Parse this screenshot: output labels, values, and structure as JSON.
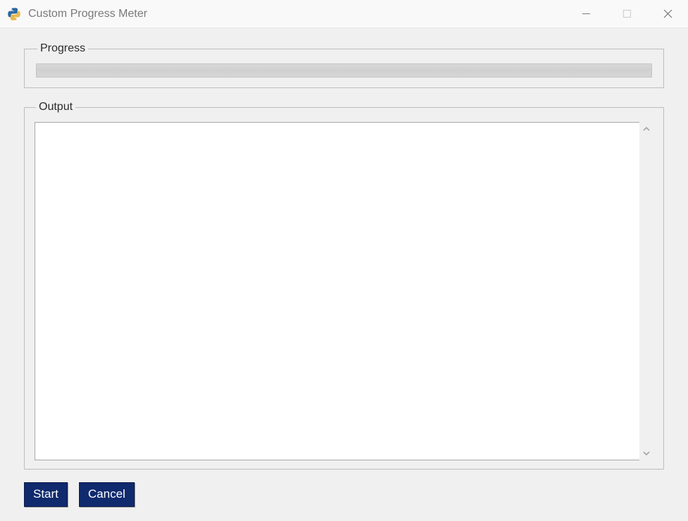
{
  "window": {
    "title": "Custom Progress Meter"
  },
  "groups": {
    "progress_label": "Progress",
    "output_label": "Output"
  },
  "progress": {
    "percent": 0
  },
  "output": {
    "text": ""
  },
  "buttons": {
    "start_label": "Start",
    "cancel_label": "Cancel"
  },
  "icons": {
    "app": "python-two-snakes",
    "minimize": "minimize-icon",
    "maximize": "maximize-icon",
    "close": "close-icon",
    "scroll_up": "chevron-up-icon",
    "scroll_down": "chevron-down-icon"
  },
  "colors": {
    "button_bg": "#102a6e",
    "button_fg": "#ffffff",
    "client_bg": "#f0f0f0"
  }
}
